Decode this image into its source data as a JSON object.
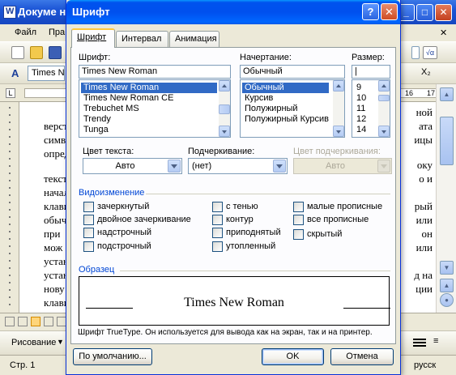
{
  "bg_window": {
    "title": "Докуме н",
    "menu": [
      "Файл",
      "Пра"
    ],
    "font_box": "Times Nev",
    "ruler_numbers": [
      "16",
      "17"
    ],
    "doc_left_lines": [
      "верст",
      "симве",
      "опред",
      "текст",
      "начал",
      "клави",
      "обыч",
      "при",
      "мож",
      "устан",
      "устан",
      "нову",
      "клави"
    ],
    "doc_right_lines": [
      "ной",
      "ата",
      "ицы",
      "оку",
      "о и",
      "рый",
      "или",
      "он",
      "или",
      "д на",
      "ции"
    ],
    "status": {
      "page": "Стр. 1",
      "lang": "русск"
    },
    "draw_label": "Рисование"
  },
  "dialog": {
    "title": "Шрифт",
    "help_label": "?",
    "close_label": "✕",
    "tabs": [
      {
        "label": "Шрифт",
        "underline": "Ш"
      },
      {
        "label": "Интервал",
        "underline": ""
      },
      {
        "label": "Анимация",
        "underline": ""
      }
    ],
    "font": {
      "label": "Шрифт:",
      "value": "Times New Roman",
      "items": [
        "Times New Roman",
        "Times New Roman CE",
        "Trebuchet MS",
        "Trendy",
        "Tunga"
      ],
      "selected_index": 0
    },
    "style": {
      "label": "Начертание:",
      "value": "Обычный",
      "items": [
        "Обычный",
        "Курсив",
        "Полужирный",
        "Полужирный Курсив"
      ],
      "selected_index": 0
    },
    "size": {
      "label": "Размер:",
      "value": "|",
      "items": [
        "9",
        "10",
        "11",
        "12",
        "14"
      ]
    },
    "text_color": {
      "label": "Цвет текста:",
      "value": "Авто"
    },
    "underline": {
      "label": "Подчеркивание:",
      "value": "(нет)"
    },
    "underline_color": {
      "label": "Цвет подчеркивания:",
      "value": "Авто"
    },
    "effects": {
      "title": "Видоизменение",
      "col1": [
        "зачеркнутый",
        "двойное зачеркивание",
        "надстрочный",
        "подстрочный"
      ],
      "col2": [
        "с тенью",
        "контур",
        "приподнятый",
        "утопленный"
      ],
      "col3": [
        "малые прописные",
        "все прописные",
        "скрытый"
      ]
    },
    "preview": {
      "title": "Образец",
      "sample": "Times New Roman",
      "note": "Шрифт TrueType. Он используется для вывода как на экран, так и на принтер."
    },
    "buttons": {
      "default": "По умолчанию...",
      "ok": "OK",
      "cancel": "Отмена"
    }
  },
  "colors": {
    "selection": "#316ac5",
    "titlebar": "#0058e6",
    "group_title": "#0046d5"
  }
}
